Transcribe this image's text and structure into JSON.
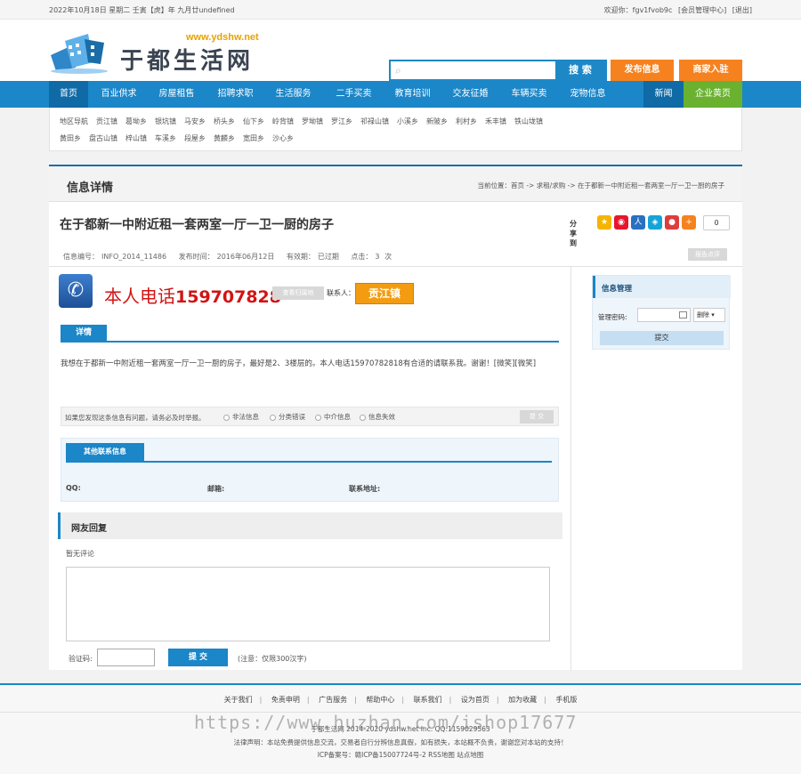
{
  "topbar": {
    "date": "2022年10月18日 星期二 壬寅【虎】年 九月廿undefined",
    "welcome": "欢迎你：fgv1fvob9c",
    "member_center": "[会员管理中心]",
    "logout": "[退出]"
  },
  "header": {
    "logo_site": "www.ydshw.net",
    "logo_name": "于都生活网",
    "search_button": "搜 索",
    "post_button": "发布信息",
    "merchant_button": "商家入驻"
  },
  "nav": {
    "items": [
      "首页",
      "百业供求",
      "房屋租售",
      "招聘求职",
      "生活服务",
      "二手买卖",
      "教育培训",
      "交友征婚",
      "车辆买卖",
      "宠物信息"
    ],
    "news": "新闻",
    "yellow_pages": "企业黄页"
  },
  "areas": {
    "row1": [
      "地区导航",
      "贡江镇",
      "葛坳乡",
      "银坑镇",
      "马安乡",
      "桥头乡",
      "仙下乡",
      "岭背镇",
      "罗坳镇",
      "罗江乡",
      "祁禄山镇",
      "小溪乡",
      "新陂乡",
      "利村乡",
      "禾丰镇",
      "铁山垅镇"
    ],
    "row2": [
      "黄田乡",
      "盘古山镇",
      "梓山镇",
      "车溪乡",
      "段屋乡",
      "黄麟乡",
      "宽田乡",
      "沙心乡"
    ]
  },
  "panel": {
    "heading": "信息详情",
    "breadcrumb": "当前位置：首页 -> 求租/求购 -> 在于都新一中附近租一套两室一厅一卫一厨的房子",
    "title": "在于都新一中附近租一套两室一厅一卫一厨的房子",
    "share_label": "分享到",
    "share_count": "0",
    "meta": {
      "id_label": "信息编号：",
      "id": "INFO_2014_11486",
      "date_label": "发布时间：",
      "date": "2016年06月12日",
      "valid_label": "有效期：",
      "valid": "已过期",
      "clicks_label": "点击：",
      "clicks": "3",
      "clicks_unit": "次"
    },
    "report_top": "报告点评",
    "phone_prefix": "本人电话",
    "phone": "159707828",
    "location_button": "查看归属地",
    "contact_label": "联系人：",
    "contact_name": "贡江镇",
    "tab_detail": "详情",
    "description": "我想在于都新一中附近租一套两室一厅一卫一厨的房子，最好是2、3楼层的。本人电话15970782818有合适的请联系我。谢谢！[微笑][微笑]",
    "report": {
      "question": "如果您发现这条信息有问题，请务必及时举报。",
      "options": [
        "非法信息",
        "分类错误",
        "中介信息",
        "信息失效"
      ],
      "button": "提 交"
    },
    "other_contact": {
      "tab": "其他联系信息",
      "qq": "QQ:",
      "email": "邮箱:",
      "address": "联系地址:"
    },
    "reply_heading": "网友回复",
    "no_comment": "暂无评论",
    "captcha_label": "验证码:",
    "submit": "提 交",
    "note": "(注意：仅限300汉字)"
  },
  "sidebar": {
    "heading": "信息管理",
    "password_label": "管理密码:",
    "select_value": "删除",
    "submit": "提交"
  },
  "footer": {
    "links": [
      "关于我们",
      "免责申明",
      "广告服务",
      "帮助中心",
      "联系我们",
      "设为首页",
      "加为收藏",
      "手机版"
    ],
    "copyright": "于都生活网 2014-2020 ydshw.net Inc. QQ:1159029563",
    "disclaimer": "法律声明：本站免费提供信息交流，交易者自行分辨信息真假，如有损失，本站概不负责，谢谢您对本站的支持！",
    "icp": "ICP备案号：赣ICP备15007724号-2   RSS地图 站点地图"
  },
  "watermark": "https://www.huzhan.com/ishop17677"
}
